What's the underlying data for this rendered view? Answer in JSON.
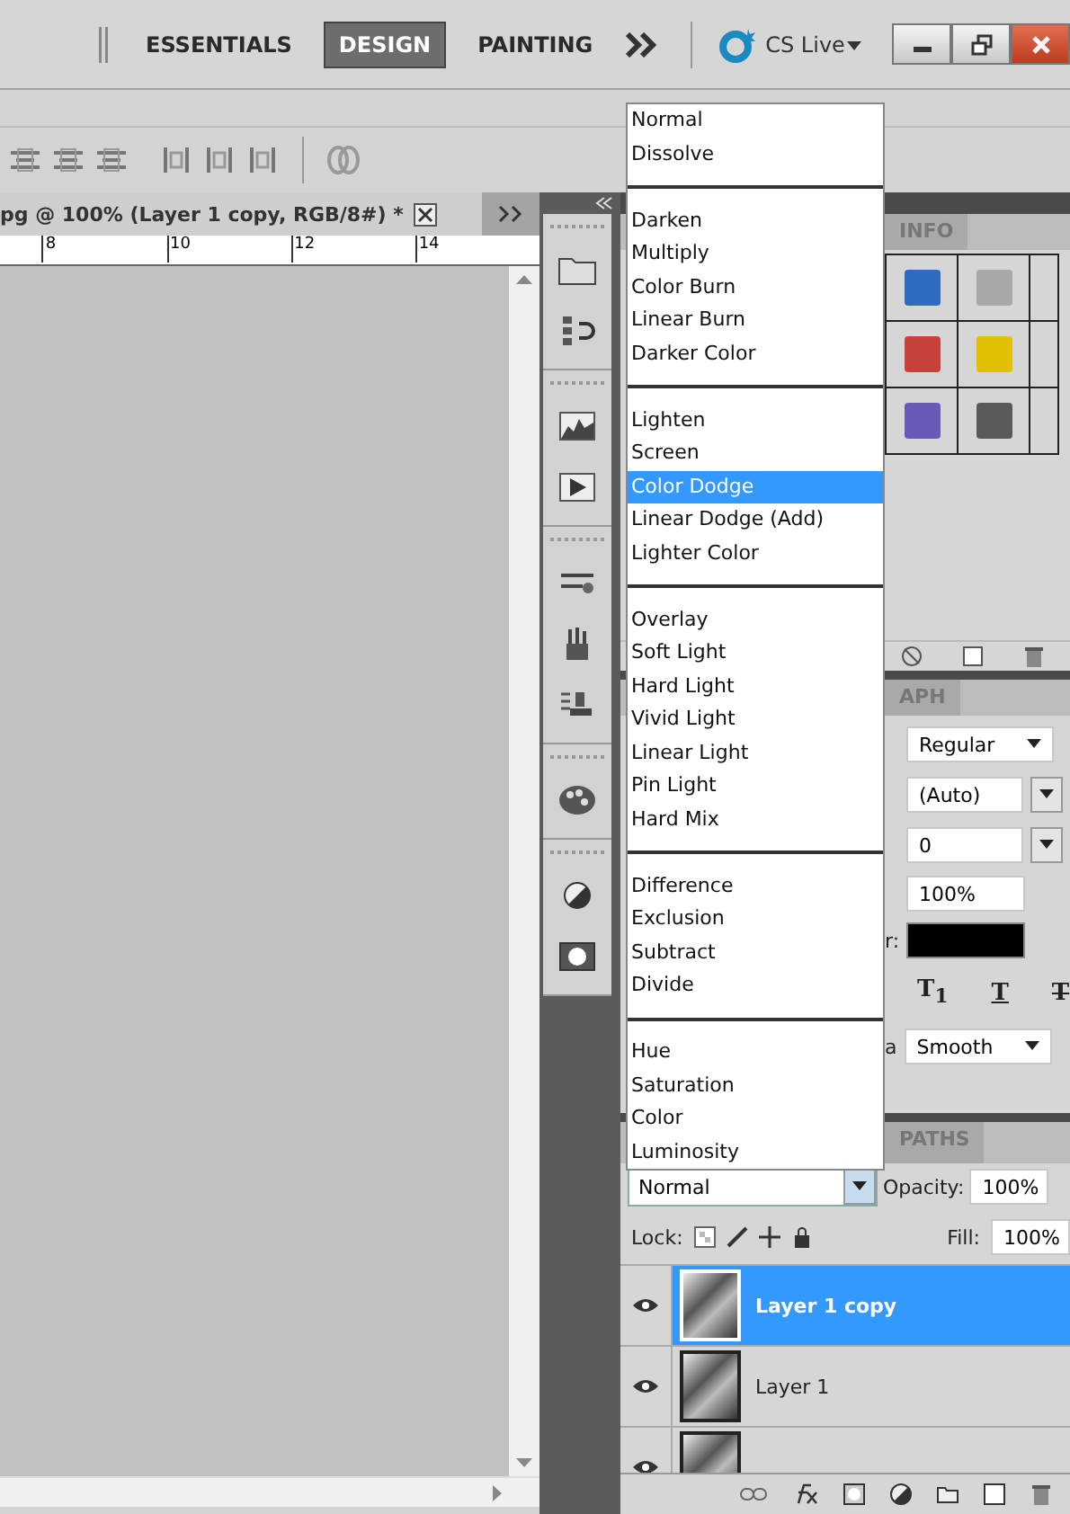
{
  "workspace_bar": {
    "items": [
      {
        "label": "ESSENTIALS",
        "selected": false
      },
      {
        "label": "DESIGN",
        "selected": true
      },
      {
        "label": "PAINTING",
        "selected": false
      }
    ],
    "cs_live": "CS Live"
  },
  "document": {
    "tab_title": "pg @ 100% (Layer 1 copy, RGB/8#) *",
    "ruler_ticks": [
      "8",
      "10",
      "12",
      "14"
    ]
  },
  "styles_panel": {
    "tab": "INFO",
    "swatches": [
      {
        "color": "#2d6cc0"
      },
      {
        "color": "#a8a8a8"
      },
      {
        "color": "#c8403a"
      },
      {
        "color": "#e0c000"
      },
      {
        "color": "#6a5ab8"
      },
      {
        "color": "#5a5a5a"
      }
    ]
  },
  "character_panel": {
    "tab": "APH",
    "font_style": "Regular",
    "leading": "(Auto)",
    "tracking": "0",
    "scale": "100%",
    "color_label": "r:",
    "style_buttons": [
      {
        "glyph": "T$_{1}$",
        "kind": "subscript"
      },
      {
        "glyph": "T",
        "kind": "underline"
      },
      {
        "glyph": "T",
        "kind": "strike"
      }
    ],
    "antialias_label": "a",
    "antialias": "Smooth"
  },
  "blend_menu": {
    "groups": [
      {
        "items": [
          {
            "label": "Normal",
            "selected": false
          },
          {
            "label": "Dissolve",
            "selected": false
          }
        ]
      },
      {
        "items": [
          {
            "label": "Darken",
            "selected": false
          },
          {
            "label": "Multiply",
            "selected": false
          },
          {
            "label": "Color Burn",
            "selected": false
          },
          {
            "label": "Linear Burn",
            "selected": false
          },
          {
            "label": "Darker Color",
            "selected": false
          }
        ]
      },
      {
        "items": [
          {
            "label": "Lighten",
            "selected": false
          },
          {
            "label": "Screen",
            "selected": false
          },
          {
            "label": "Color Dodge",
            "selected": true
          },
          {
            "label": "Linear Dodge (Add)",
            "selected": false
          },
          {
            "label": "Lighter Color",
            "selected": false
          }
        ]
      },
      {
        "items": [
          {
            "label": "Overlay",
            "selected": false
          },
          {
            "label": "Soft Light",
            "selected": false
          },
          {
            "label": "Hard Light",
            "selected": false
          },
          {
            "label": "Vivid Light",
            "selected": false
          },
          {
            "label": "Linear Light",
            "selected": false
          },
          {
            "label": "Pin Light",
            "selected": false
          },
          {
            "label": "Hard Mix",
            "selected": false
          }
        ]
      },
      {
        "items": [
          {
            "label": "Difference",
            "selected": false
          },
          {
            "label": "Exclusion",
            "selected": false
          },
          {
            "label": "Subtract",
            "selected": false
          },
          {
            "label": "Divide",
            "selected": false
          }
        ]
      },
      {
        "items": [
          {
            "label": "Hue",
            "selected": false
          },
          {
            "label": "Saturation",
            "selected": false
          },
          {
            "label": "Color",
            "selected": false
          },
          {
            "label": "Luminosity",
            "selected": false
          }
        ]
      }
    ]
  },
  "layers_panel": {
    "tab": "PATHS",
    "blend_mode": "Normal",
    "opacity_label": "Opacity:",
    "opacity": "100%",
    "lock_label": "Lock:",
    "fill_label": "Fill:",
    "fill": "100%",
    "layers": [
      {
        "name": "Layer 1 copy",
        "selected": true,
        "visible": true
      },
      {
        "name": "Layer 1",
        "selected": false,
        "visible": true
      },
      {
        "selected": false,
        "visible": true
      }
    ]
  }
}
